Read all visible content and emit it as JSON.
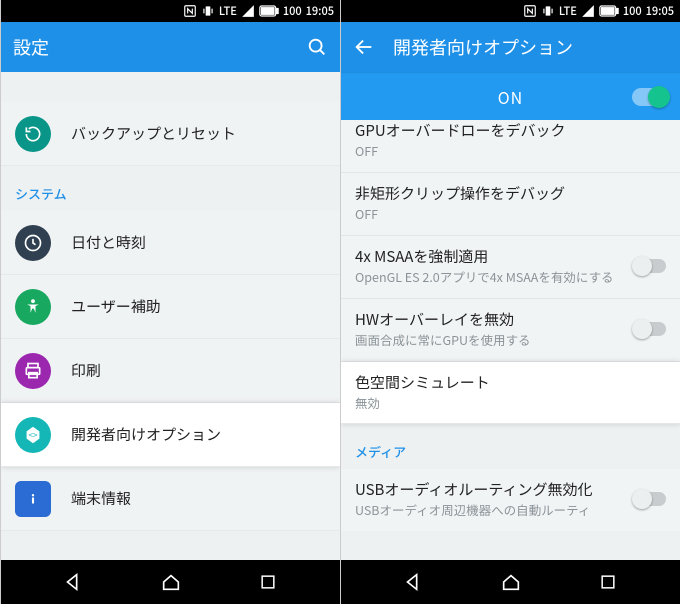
{
  "status": {
    "lte": "LTE",
    "battery": "100",
    "time": "19:05"
  },
  "left": {
    "title": "設定",
    "rows": {
      "backup": "バックアップとリセット",
      "section_system": "システム",
      "datetime": "日付と時刻",
      "accessibility": "ユーザー補助",
      "print": "印刷",
      "devopts": "開発者向けオプション",
      "about": "端末情報"
    }
  },
  "right": {
    "title": "開発者向けオプション",
    "master_switch": "ON",
    "rows": {
      "gpu_overdraw": {
        "t": "GPUオーバードローをデバック",
        "s": "OFF"
      },
      "clip": {
        "t": "非矩形クリップ操作をデバッグ",
        "s": "OFF"
      },
      "msaa": {
        "t": "4x MSAAを強制適用",
        "s": "OpenGL ES 2.0アプリで4x MSAAを有効にする"
      },
      "hw": {
        "t": "HWオーバーレイを無効",
        "s": "画面合成に常にGPUを使用する"
      },
      "color": {
        "t": "色空間シミュレート",
        "s": "無効"
      },
      "section_media": "メディア",
      "usb": {
        "t": "USBオーディオルーティング無効化",
        "s": "USBオーディオ周辺機器への自動ルーティ"
      }
    }
  }
}
